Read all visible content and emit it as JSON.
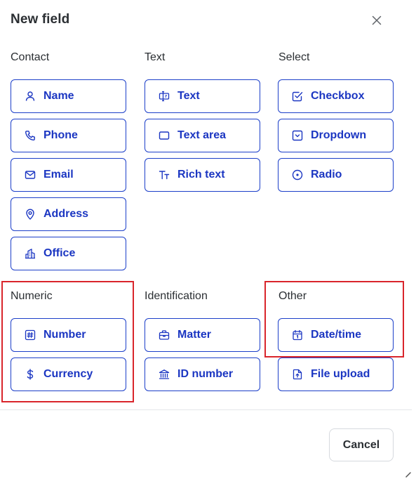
{
  "dialog": {
    "title": "New field",
    "close_icon": "close-icon"
  },
  "sections": {
    "contact": {
      "label": "Contact",
      "items": [
        {
          "label": "Name",
          "icon": "user-icon"
        },
        {
          "label": "Phone",
          "icon": "phone-icon"
        },
        {
          "label": "Email",
          "icon": "mail-icon"
        },
        {
          "label": "Address",
          "icon": "map-pin-icon"
        },
        {
          "label": "Office",
          "icon": "building-icon"
        }
      ]
    },
    "text": {
      "label": "Text",
      "items": [
        {
          "label": "Text",
          "icon": "text-cursor-icon"
        },
        {
          "label": "Text area",
          "icon": "textarea-icon"
        },
        {
          "label": "Rich text",
          "icon": "rich-text-icon"
        }
      ]
    },
    "select": {
      "label": "Select",
      "items": [
        {
          "label": "Checkbox",
          "icon": "checkbox-icon"
        },
        {
          "label": "Dropdown",
          "icon": "dropdown-icon"
        },
        {
          "label": "Radio",
          "icon": "radio-icon"
        }
      ]
    },
    "numeric": {
      "label": "Numeric",
      "items": [
        {
          "label": "Number",
          "icon": "hash-icon"
        },
        {
          "label": "Currency",
          "icon": "dollar-icon"
        }
      ]
    },
    "identification": {
      "label": "Identification",
      "items": [
        {
          "label": "Matter",
          "icon": "briefcase-icon"
        },
        {
          "label": "ID number",
          "icon": "institution-icon"
        }
      ]
    },
    "other": {
      "label": "Other",
      "items": [
        {
          "label": "Date/time",
          "icon": "calendar-icon"
        },
        {
          "label": "File upload",
          "icon": "file-upload-icon"
        }
      ]
    }
  },
  "footer": {
    "cancel_label": "Cancel"
  },
  "colors": {
    "accent": "#1b36c2",
    "highlight": "#d9252b",
    "title": "#2b2f33"
  }
}
